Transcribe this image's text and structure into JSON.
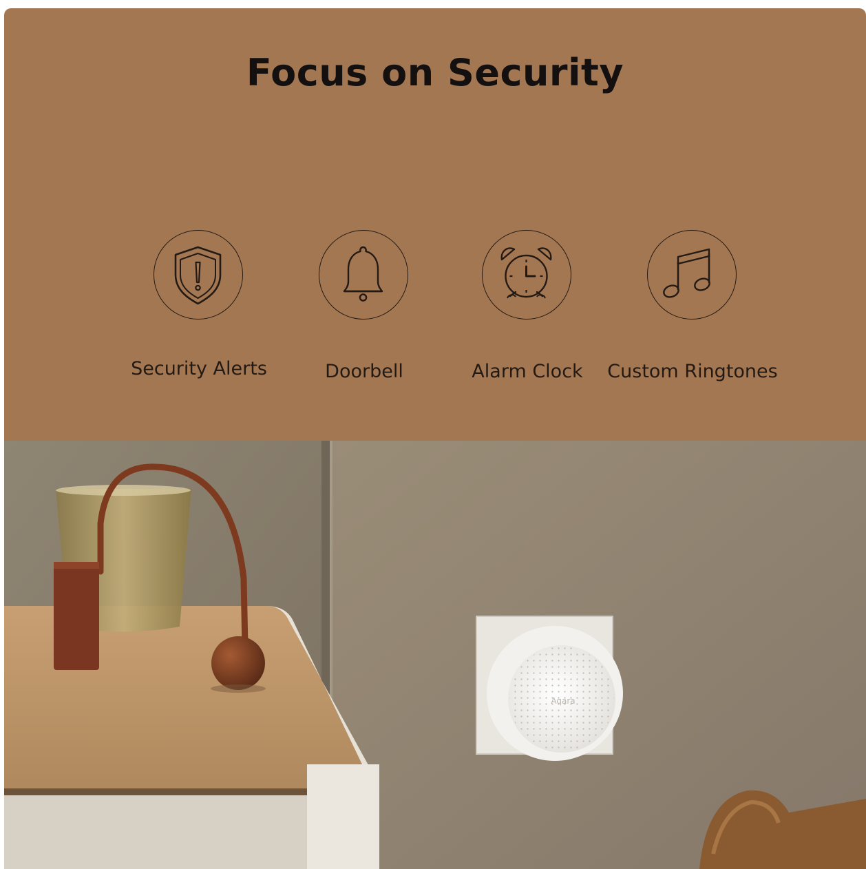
{
  "header": {
    "title": "Focus on Security"
  },
  "features": [
    {
      "label": "Security Alerts",
      "icon": "shield-alert-icon"
    },
    {
      "label": "Doorbell",
      "icon": "bell-icon"
    },
    {
      "label": "Alarm Clock",
      "icon": "alarm-clock-icon"
    },
    {
      "label": "Custom Ringtones",
      "icon": "music-note-icon"
    }
  ],
  "photo": {
    "device_brand": "Aqara"
  },
  "colors": {
    "panel": "#a47753",
    "text": "#141010",
    "line": "#231a14"
  }
}
